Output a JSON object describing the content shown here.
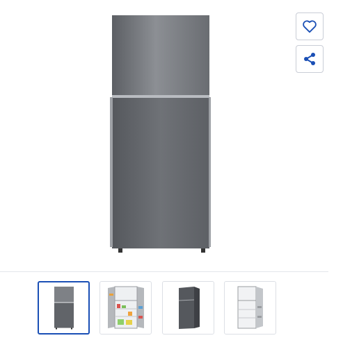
{
  "product": {
    "main_image_icon": "refrigerator-front-view",
    "selected_thumbnail": 0
  },
  "actions": {
    "favorite_icon": "heart-icon",
    "share_icon": "share-icon",
    "accent_color": "#1a4fb5"
  },
  "gallery": {
    "thumbnails": [
      {
        "icon": "refrigerator-front-view",
        "selected": true
      },
      {
        "icon": "refrigerator-doors-open-view",
        "selected": false
      },
      {
        "icon": "refrigerator-angled-view",
        "selected": false
      },
      {
        "icon": "refrigerator-doors-open-empty-view",
        "selected": false
      }
    ]
  }
}
